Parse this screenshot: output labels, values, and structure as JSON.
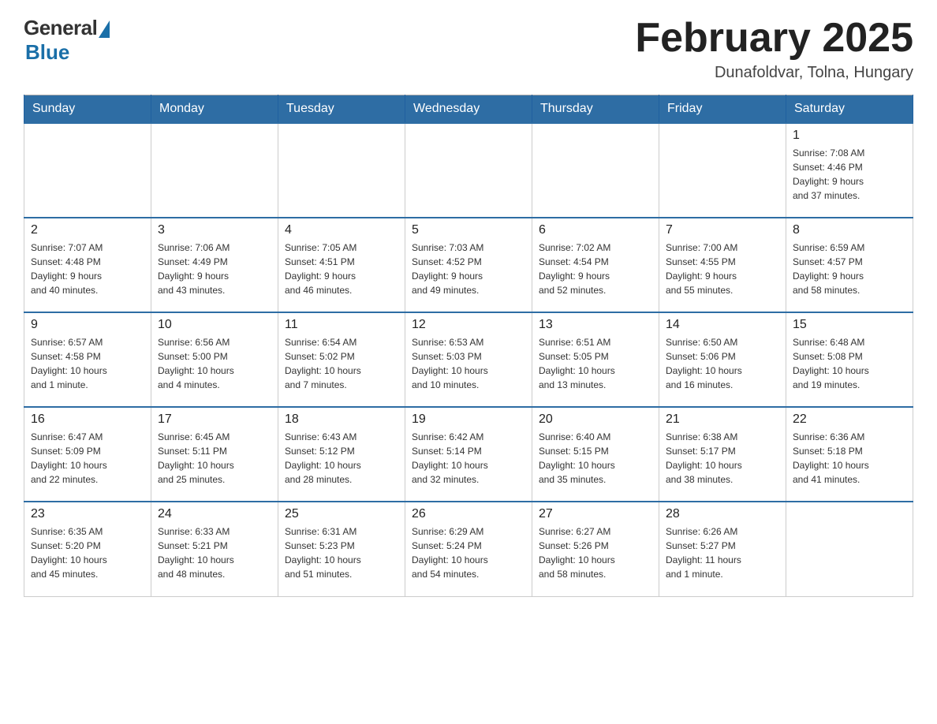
{
  "header": {
    "logo_general": "General",
    "logo_blue": "Blue",
    "month_title": "February 2025",
    "location": "Dunafoldvar, Tolna, Hungary"
  },
  "weekdays": [
    "Sunday",
    "Monday",
    "Tuesday",
    "Wednesday",
    "Thursday",
    "Friday",
    "Saturday"
  ],
  "weeks": [
    [
      {
        "day": "",
        "info": ""
      },
      {
        "day": "",
        "info": ""
      },
      {
        "day": "",
        "info": ""
      },
      {
        "day": "",
        "info": ""
      },
      {
        "day": "",
        "info": ""
      },
      {
        "day": "",
        "info": ""
      },
      {
        "day": "1",
        "info": "Sunrise: 7:08 AM\nSunset: 4:46 PM\nDaylight: 9 hours\nand 37 minutes."
      }
    ],
    [
      {
        "day": "2",
        "info": "Sunrise: 7:07 AM\nSunset: 4:48 PM\nDaylight: 9 hours\nand 40 minutes."
      },
      {
        "day": "3",
        "info": "Sunrise: 7:06 AM\nSunset: 4:49 PM\nDaylight: 9 hours\nand 43 minutes."
      },
      {
        "day": "4",
        "info": "Sunrise: 7:05 AM\nSunset: 4:51 PM\nDaylight: 9 hours\nand 46 minutes."
      },
      {
        "day": "5",
        "info": "Sunrise: 7:03 AM\nSunset: 4:52 PM\nDaylight: 9 hours\nand 49 minutes."
      },
      {
        "day": "6",
        "info": "Sunrise: 7:02 AM\nSunset: 4:54 PM\nDaylight: 9 hours\nand 52 minutes."
      },
      {
        "day": "7",
        "info": "Sunrise: 7:00 AM\nSunset: 4:55 PM\nDaylight: 9 hours\nand 55 minutes."
      },
      {
        "day": "8",
        "info": "Sunrise: 6:59 AM\nSunset: 4:57 PM\nDaylight: 9 hours\nand 58 minutes."
      }
    ],
    [
      {
        "day": "9",
        "info": "Sunrise: 6:57 AM\nSunset: 4:58 PM\nDaylight: 10 hours\nand 1 minute."
      },
      {
        "day": "10",
        "info": "Sunrise: 6:56 AM\nSunset: 5:00 PM\nDaylight: 10 hours\nand 4 minutes."
      },
      {
        "day": "11",
        "info": "Sunrise: 6:54 AM\nSunset: 5:02 PM\nDaylight: 10 hours\nand 7 minutes."
      },
      {
        "day": "12",
        "info": "Sunrise: 6:53 AM\nSunset: 5:03 PM\nDaylight: 10 hours\nand 10 minutes."
      },
      {
        "day": "13",
        "info": "Sunrise: 6:51 AM\nSunset: 5:05 PM\nDaylight: 10 hours\nand 13 minutes."
      },
      {
        "day": "14",
        "info": "Sunrise: 6:50 AM\nSunset: 5:06 PM\nDaylight: 10 hours\nand 16 minutes."
      },
      {
        "day": "15",
        "info": "Sunrise: 6:48 AM\nSunset: 5:08 PM\nDaylight: 10 hours\nand 19 minutes."
      }
    ],
    [
      {
        "day": "16",
        "info": "Sunrise: 6:47 AM\nSunset: 5:09 PM\nDaylight: 10 hours\nand 22 minutes."
      },
      {
        "day": "17",
        "info": "Sunrise: 6:45 AM\nSunset: 5:11 PM\nDaylight: 10 hours\nand 25 minutes."
      },
      {
        "day": "18",
        "info": "Sunrise: 6:43 AM\nSunset: 5:12 PM\nDaylight: 10 hours\nand 28 minutes."
      },
      {
        "day": "19",
        "info": "Sunrise: 6:42 AM\nSunset: 5:14 PM\nDaylight: 10 hours\nand 32 minutes."
      },
      {
        "day": "20",
        "info": "Sunrise: 6:40 AM\nSunset: 5:15 PM\nDaylight: 10 hours\nand 35 minutes."
      },
      {
        "day": "21",
        "info": "Sunrise: 6:38 AM\nSunset: 5:17 PM\nDaylight: 10 hours\nand 38 minutes."
      },
      {
        "day": "22",
        "info": "Sunrise: 6:36 AM\nSunset: 5:18 PM\nDaylight: 10 hours\nand 41 minutes."
      }
    ],
    [
      {
        "day": "23",
        "info": "Sunrise: 6:35 AM\nSunset: 5:20 PM\nDaylight: 10 hours\nand 45 minutes."
      },
      {
        "day": "24",
        "info": "Sunrise: 6:33 AM\nSunset: 5:21 PM\nDaylight: 10 hours\nand 48 minutes."
      },
      {
        "day": "25",
        "info": "Sunrise: 6:31 AM\nSunset: 5:23 PM\nDaylight: 10 hours\nand 51 minutes."
      },
      {
        "day": "26",
        "info": "Sunrise: 6:29 AM\nSunset: 5:24 PM\nDaylight: 10 hours\nand 54 minutes."
      },
      {
        "day": "27",
        "info": "Sunrise: 6:27 AM\nSunset: 5:26 PM\nDaylight: 10 hours\nand 58 minutes."
      },
      {
        "day": "28",
        "info": "Sunrise: 6:26 AM\nSunset: 5:27 PM\nDaylight: 11 hours\nand 1 minute."
      },
      {
        "day": "",
        "info": ""
      }
    ]
  ]
}
